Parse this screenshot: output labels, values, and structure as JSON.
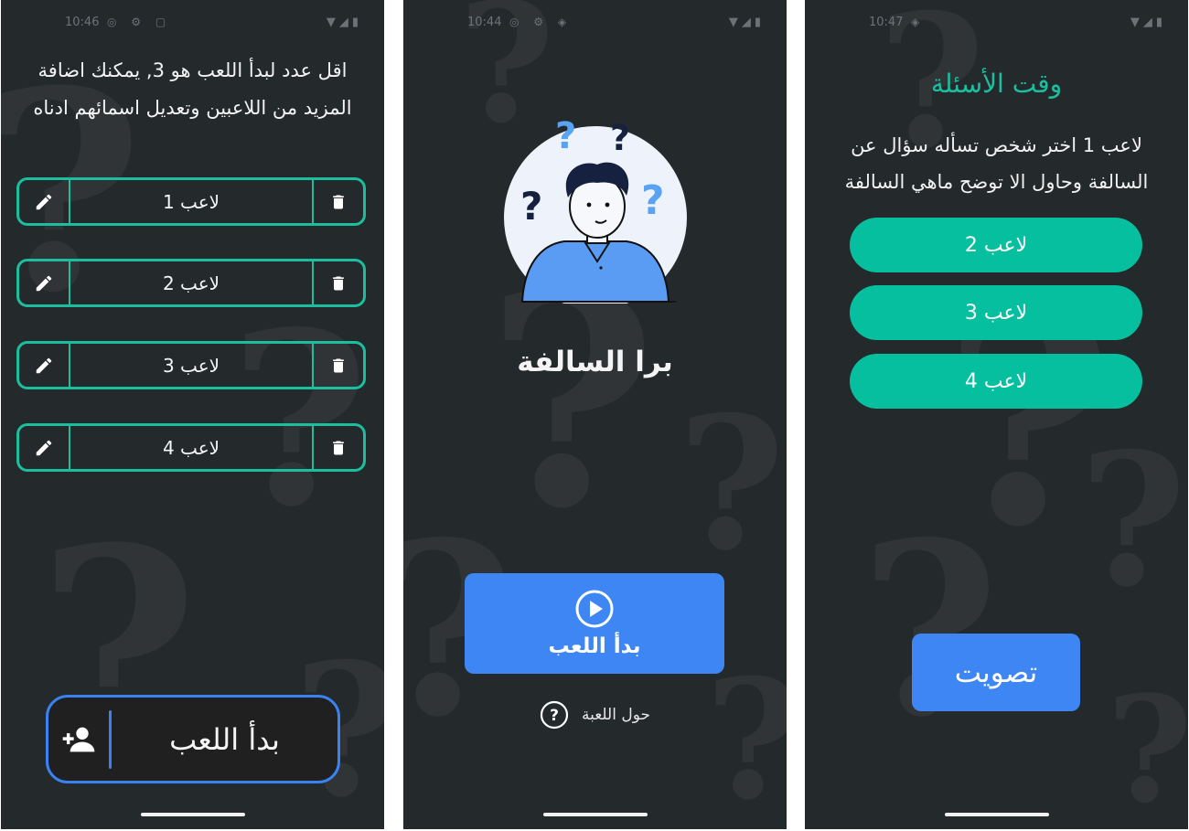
{
  "colors": {
    "screen_bg": "#24292c",
    "accent_green": "#1bbf9f",
    "accent_blue": "#3d86f3",
    "text": "#f3f3f3"
  },
  "screen1": {
    "status": {
      "time": "10:46"
    },
    "intro": "اقل عدد لبدأ اللعب هو 3, يمكنك اضافة المزيد من اللاعبين وتعديل اسمائهم ادناه",
    "players": [
      {
        "name": "لاعب 1",
        "edit_icon": "pencil-icon",
        "delete_icon": "trash-icon"
      },
      {
        "name": "لاعب 2",
        "edit_icon": "pencil-icon",
        "delete_icon": "trash-icon"
      },
      {
        "name": "لاعب 3",
        "edit_icon": "pencil-icon",
        "delete_icon": "trash-icon"
      },
      {
        "name": "لاعب 4",
        "edit_icon": "pencil-icon",
        "delete_icon": "trash-icon"
      }
    ],
    "start_label": "بدأ اللعب",
    "add_player_icon": "add-person-icon"
  },
  "screen2": {
    "status": {
      "time": "10:44"
    },
    "title": "برا السالفة",
    "play_label": "بدأ اللعب",
    "play_icon": "play-circle-icon",
    "about_label": "حول اللعبة",
    "about_icon": "help-circle-icon"
  },
  "screen3": {
    "status": {
      "time": "10:47"
    },
    "title": "وقت الأسئلة",
    "instruction": "لاعب 1 اختر شخص تسأله سؤال عن السالفة وحاول الا توضح ماهي السالفة",
    "choices": [
      "لاعب 2",
      "لاعب 3",
      "لاعب 4"
    ],
    "vote_label": "تصويت"
  }
}
